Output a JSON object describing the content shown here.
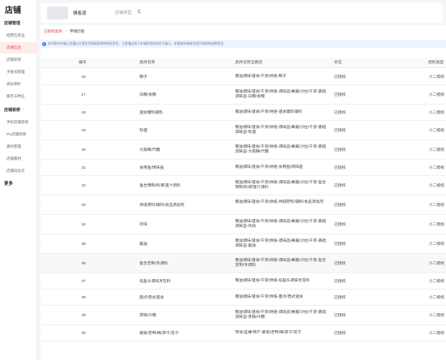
{
  "sidebar": {
    "title": "店铺",
    "items": [
      {
        "label": "店铺管理",
        "type": "group"
      },
      {
        "label": "经营信息证",
        "type": "item"
      },
      {
        "label": "店铺信息",
        "type": "item",
        "active": true
      },
      {
        "label": "店铺装修",
        "type": "item"
      },
      {
        "label": "子账号管理",
        "type": "item"
      },
      {
        "label": "商标保护",
        "type": "item"
      },
      {
        "label": "服务与供应",
        "type": "item"
      },
      {
        "label": "店铺装修",
        "type": "group"
      },
      {
        "label": "手机店铺装修",
        "type": "item"
      },
      {
        "label": "PC店铺装修",
        "type": "item"
      },
      {
        "label": "素材管理",
        "type": "item"
      },
      {
        "label": "店铺素材",
        "type": "item"
      },
      {
        "label": "店铺动态页",
        "type": "item"
      },
      {
        "label": "更多",
        "type": "more"
      }
    ]
  },
  "topcard": {
    "shop_name": "雅客源",
    "shop_type_label": "店铺类型:",
    "shop_type_value": "C"
  },
  "breadcrumb": {
    "link": "已授权类目",
    "sep": "/",
    "current": "申请历程"
  },
  "notice": "本列表中仅展示您通过主营类目授权获得的授权类目，之前通过线下申请获得的类目不展示，如需查询请前往类目授权和经营类目。",
  "table": {
    "headers": [
      "编号",
      "类目名称",
      "类目名称全路径",
      "状态",
      "授权类型"
    ],
    "rows": [
      {
        "no": "16",
        "name": "粽子",
        "path": "粮油调味/速食/干货/烘焙-粽子",
        "status": "已授权",
        "type": "小二授权"
      },
      {
        "no": "17",
        "name": "白糖/食糖",
        "path": "粮油调味/速食/干货/烘焙-调味品/果酱/沙拉/干货-基础调味品-白糖/食糖",
        "status": "已授权",
        "type": "小二授权"
      },
      {
        "no": "18",
        "name": "速食罐料辅料",
        "path": "粮油调味/速食/干货/烘焙-速食罐料辅料",
        "status": "已授权",
        "type": "小二授权"
      },
      {
        "no": "19",
        "name": "料酒",
        "path": "粮油调味/速食/干货/烘焙-调味品/果酱/沙拉/干货-基础调味品-料酒",
        "status": "已授权",
        "type": "小二授权"
      },
      {
        "no": "20",
        "name": "大蒜精/代糖",
        "path": "粮油调味/速食/干货/烘焙-调味品/果酱/沙拉/干货-基础调味品-大蒜精/代糖",
        "status": "已授权",
        "type": "小二授权"
      },
      {
        "no": "21",
        "name": "食用盐/烤味盐",
        "path": "粮油调味/速食/干货/烘焙-食用盐/烤味盐",
        "status": "已授权",
        "type": "小二授权"
      },
      {
        "no": "22",
        "name": "复合预制/料/即速汁调料",
        "path": "粮油调味/速食/干货/烘焙-调味品/果酱/沙拉/干货-复合预制/料/即速汁调料",
        "status": "已授权",
        "type": "小二授权"
      },
      {
        "no": "23",
        "name": "烘培原料/辅料/食品添加剂",
        "path": "粮油调味/速食/干货/烘焙-烘焙原料/辅料/食品添加剂",
        "status": "已授权",
        "type": "小二授权"
      },
      {
        "no": "24",
        "name": "鸡块",
        "path": "粮油调味/速食/干货/烘焙-调味品/果酱/沙拉/干货-基础调味品-鸡块",
        "status": "已授权",
        "type": "小二授权"
      },
      {
        "no": "25",
        "name": "酱油",
        "path": "粮油调味/速食/干货/烘焙-调味品/果酱/沙拉/干货-基础调味品-酱油",
        "status": "已授权",
        "type": "小二授权"
      },
      {
        "no": "26",
        "name": "复合定制/烹调料",
        "path": "粮油调味/速食/干货/烘焙-调味品/果酱/沙拉/干货-复合定制/烹调料",
        "status": "已授权",
        "type": "小二授权"
      },
      {
        "no": "27",
        "name": "低盐头调味烹饪料",
        "path": "粮油调味/速食/干货/烘焙-低盐头调味烹饪料",
        "status": "已授权",
        "type": "小二授权"
      },
      {
        "no": "28",
        "name": "面点/西式速食",
        "path": "粮油调味/速食/干货/烘焙-面点/西式速食",
        "status": "已授权",
        "type": "小二授权"
      },
      {
        "no": "29",
        "name": "蒸锅/冷糖",
        "path": "粮油调味/速食/干货/烘焙-调味品/果酱/沙拉/干货-基础调味品-蒸锅/冷糖",
        "status": "已授权",
        "type": "小二授权"
      },
      {
        "no": "30",
        "name": "蒙笼/老鸭/梅/笋干/花干",
        "path": "零食/坚果/特产-蒙笼/老鸭/梅/笋干/花干",
        "status": "已授权",
        "type": "小二授权"
      }
    ]
  }
}
